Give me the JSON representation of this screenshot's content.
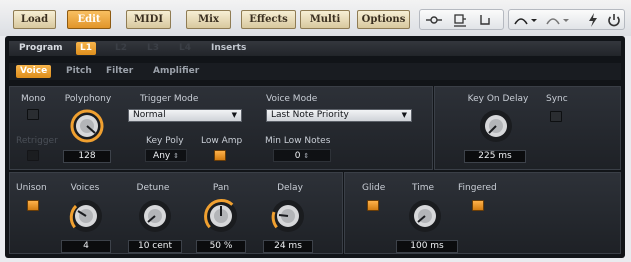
{
  "toolbar": {
    "buttons": [
      "Load",
      "Edit",
      "MIDI",
      "Mix",
      "Effects",
      "Multi",
      "Options"
    ],
    "active": "Edit",
    "icons": [
      "network-icon",
      "notation-icon",
      "routing-icon",
      "curve-down-icon",
      "curve-icon",
      "lightning-icon",
      "power-icon"
    ]
  },
  "program_bar": {
    "label": "Program",
    "tabs": [
      "L1",
      "L2",
      "L3",
      "L4"
    ],
    "active_tab": "L1",
    "inserts": "Inserts"
  },
  "subtabs": {
    "items": [
      "Voice",
      "Pitch",
      "Filter",
      "Amplifier"
    ],
    "active": "Voice"
  },
  "voice": {
    "mono": "Mono",
    "retrigger": "Retrigger",
    "polyphony_label": "Polyphony",
    "polyphony_value": "128",
    "trigger_mode_label": "Trigger Mode",
    "trigger_mode_value": "Normal",
    "voice_mode_label": "Voice Mode",
    "voice_mode_value": "Last Note Priority",
    "key_poly_label": "Key Poly",
    "key_poly_value": "Any",
    "low_amp_label": "Low Amp",
    "min_low_notes_label": "Min Low Notes",
    "min_low_notes_value": "0",
    "key_on_delay_label": "Key On Delay",
    "key_on_delay_value": "225 ms",
    "sync_label": "Sync"
  },
  "unison": {
    "unison_label": "Unison",
    "voices_label": "Voices",
    "voices_value": "4",
    "detune_label": "Detune",
    "detune_value": "10 cent",
    "pan_label": "Pan",
    "pan_value": "50 %",
    "pan_level": 0.5,
    "delay_label": "Delay",
    "delay_value": "24 ms"
  },
  "glide": {
    "glide_label": "Glide",
    "time_label": "Time",
    "time_value": "100 ms",
    "fingered_label": "Fingered"
  },
  "colors": {
    "accent": "#f0a030",
    "panel": "#1e2126",
    "brand_button": "#e8d9b0"
  }
}
